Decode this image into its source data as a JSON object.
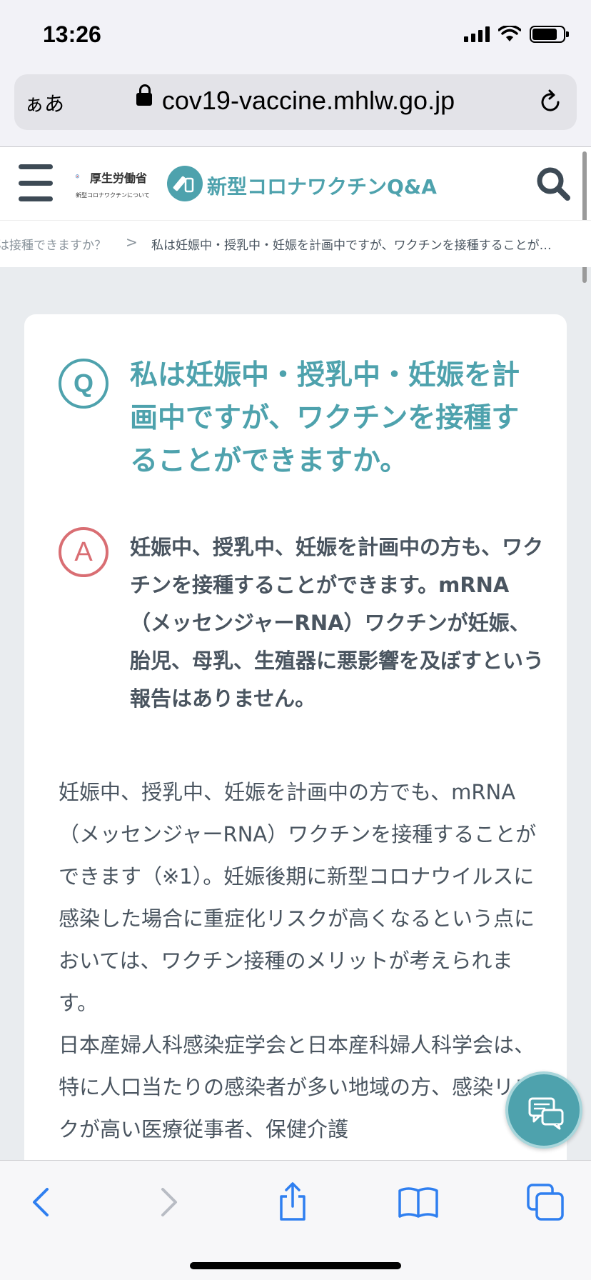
{
  "status_bar": {
    "time": "13:26"
  },
  "url_bar": {
    "aa_label": "ぁあ",
    "url": "cov19-vaccine.mhlw.go.jp"
  },
  "header": {
    "mhlw_name": "厚生労働省",
    "mhlw_sub": "新型コロナワクチンについて",
    "site_title": "新型コロナワクチンQ&A"
  },
  "breadcrumb": {
    "previous": "は接種できますか？",
    "separator": ">",
    "current": "私は妊娠中・授乳中・妊娠を計画中ですが、ワクチンを接種することが…"
  },
  "qa": {
    "q_label": "Q",
    "question": "私は妊娠中・授乳中・妊娠を計画中ですが、ワクチンを接種することができますか。",
    "a_label": "A",
    "answer": "妊娠中、授乳中、妊娠を計画中の方も、ワクチンを接種することができます。mRNA（メッセンジャーRNA）ワクチンが妊娠、胎児、母乳、生殖器に悪影響を及ぼすという報告はありません。",
    "body_paragraphs": [
      "妊娠中、授乳中、妊娠を計画中の方でも、mRNA（メッセンジャーRNA）ワクチンを接種することができます（※1）。妊娠後期に新型コロナウイルスに感染した場合に重症化リスクが高くなるという点においては、ワクチン接種のメリットが考えられます。",
      "日本産婦人科感染症学会と日本産科婦人科学会は、特に人口当たりの感染者が多い地域の方、感染リスクが高い医療従事者、保健介護"
    ]
  },
  "colors": {
    "teal": "#4ea2ad",
    "answer_red": "#d96e73",
    "text": "#4a5560"
  },
  "icons": {
    "menu": "hamburger-icon",
    "search": "search-icon",
    "chat": "chat-icon",
    "back": "back-icon",
    "forward": "forward-icon",
    "share": "share-icon",
    "bookmarks": "bookmarks-icon",
    "tabs": "tabs-icon"
  }
}
